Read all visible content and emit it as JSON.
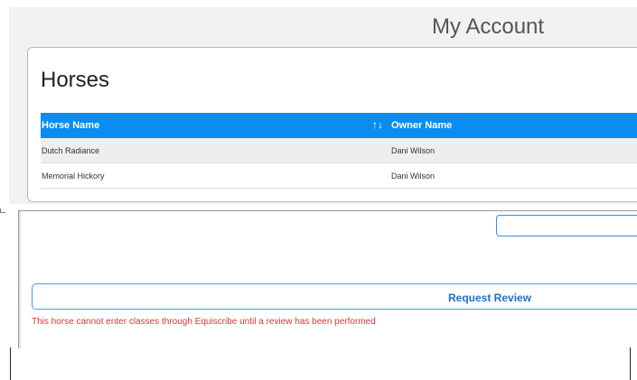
{
  "header": {
    "title": "My Account"
  },
  "horses": {
    "heading": "Horses",
    "table": {
      "columns": [
        "Horse Name",
        "Owner Name"
      ],
      "sort_icon": "↑↓",
      "rows": [
        {
          "horse_name": "Dutch Radiance",
          "owner_name": "Dani Wilson"
        },
        {
          "horse_name": "Memorial Hickory",
          "owner_name": "Dani Wilson"
        }
      ]
    }
  },
  "form": {
    "input_value": "",
    "request_review_label": "Request Review",
    "warning": "This horse cannot enter classes through Equiscribe until a review has been performed"
  },
  "colors": {
    "table_header": "#0a8cf0",
    "button_text": "#1f6fc7",
    "warning_text": "#d9363e"
  }
}
